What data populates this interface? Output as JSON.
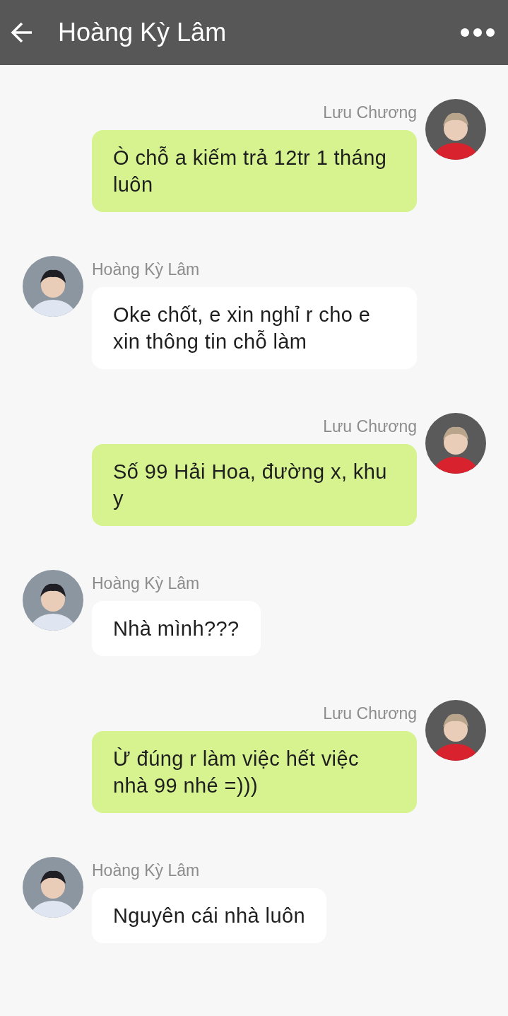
{
  "header": {
    "title": "Hoàng Kỳ Lâm"
  },
  "messages": [
    {
      "kind": "outgoing",
      "sender": "Lưu Chương",
      "text": "Ò chỗ a kiếm trả 12tr 1 tháng luôn"
    },
    {
      "kind": "incoming",
      "sender": "Hoàng Kỳ Lâm",
      "text": "Oke chốt, e xin nghỉ r cho e xin thông tin chỗ làm"
    },
    {
      "kind": "outgoing",
      "sender": "Lưu Chương",
      "text": "Số 99 Hải Hoa, đường x, khu y"
    },
    {
      "kind": "incoming",
      "sender": "Hoàng Kỳ Lâm",
      "text": "Nhà mình???"
    },
    {
      "kind": "outgoing",
      "sender": "Lưu Chương",
      "text": "Ừ đúng r làm việc hết việc nhà 99 nhé =)))"
    },
    {
      "kind": "incoming",
      "sender": "Hoàng Kỳ Lâm",
      "text": "Nguyên cái nhà luôn"
    }
  ]
}
